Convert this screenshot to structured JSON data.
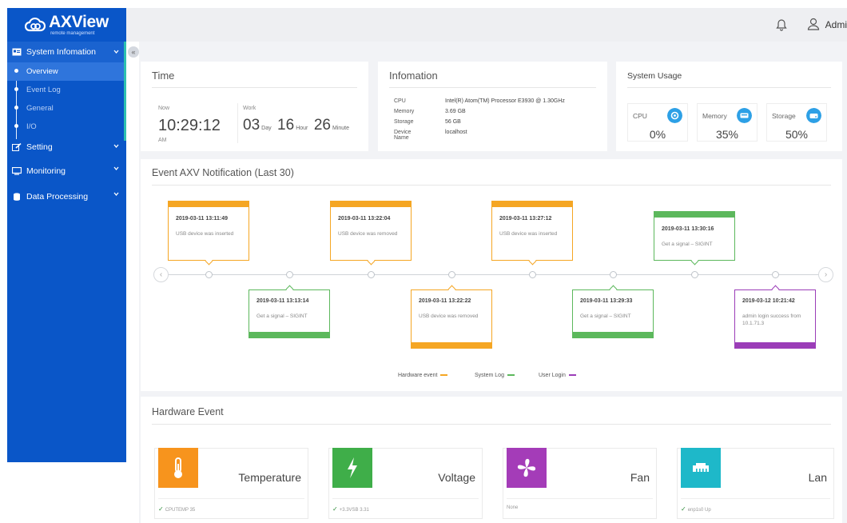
{
  "app": {
    "logo_title": "AXView",
    "logo_subtitle": "remote management",
    "user_label": "Admi"
  },
  "sidebar": {
    "groups": [
      {
        "label": "System Infomation",
        "items": [
          "Overview",
          "Event Log",
          "General",
          "I/O"
        ]
      },
      {
        "label": "Setting"
      },
      {
        "label": "Monitoring"
      },
      {
        "label": "Data Processing"
      }
    ],
    "collapse_glyph": "«"
  },
  "time_card": {
    "title": "Time",
    "now_label": "Now",
    "clock": "10:29:12",
    "ampm": "AM",
    "work_label": "Work",
    "days": "03",
    "day_unit": "Day",
    "hours": "16",
    "hour_unit": "Hour",
    "minutes": "26",
    "minute_unit": "Minute"
  },
  "info_card": {
    "title": "Infomation",
    "rows": [
      {
        "key": "CPU",
        "value": "Intel(R) Atom(TM) Processor E3930 @ 1.30GHz"
      },
      {
        "key": "Memory",
        "value": "3.69 GB"
      },
      {
        "key": "Storage",
        "value": "56 GB"
      },
      {
        "key": "Device Name",
        "value": "localhost"
      }
    ]
  },
  "usage_card": {
    "title": "System Usage",
    "cpu": {
      "label": "CPU",
      "value": "0%"
    },
    "memory": {
      "label": "Memory",
      "value": "35%"
    },
    "storage": {
      "label": "Storage",
      "value": "50%"
    }
  },
  "timeline": {
    "title": "Event AXV Notification (Last 30)",
    "prev_glyph": "‹",
    "next_glyph": "›",
    "events": [
      {
        "time": "2019-03-11 13:11:49",
        "desc": "USB device was inserted",
        "type": "hardware"
      },
      {
        "time": "2019-03-11 13:13:14",
        "desc": "Get a signal – SIGINT",
        "type": "system"
      },
      {
        "time": "2019-03-11 13:22:04",
        "desc": "USB device was removed",
        "type": "hardware"
      },
      {
        "time": "2019-03-11 13:22:22",
        "desc": "USB device was removed",
        "type": "hardware"
      },
      {
        "time": "2019-03-11 13:27:12",
        "desc": "USB device was inserted",
        "type": "hardware"
      },
      {
        "time": "2019-03-11 13:29:33",
        "desc": "Get a signal – SIGINT",
        "type": "system"
      },
      {
        "time": "2019-03-11 13:30:16",
        "desc": "Get a signal – SIGINT",
        "type": "system"
      },
      {
        "time": "2019-03-12 10:21:42",
        "desc": "admin login success from 10.1.71.3",
        "type": "login"
      }
    ],
    "legend": {
      "hardware": "Hardware event",
      "system": "System Log",
      "login": "User Login"
    },
    "colors": {
      "hardware": "#f5a623",
      "system": "#5cb85c",
      "login": "#9b3db8"
    }
  },
  "hardware_card": {
    "title": "Hardware Event",
    "items": [
      {
        "name": "Temperature",
        "status": "CPUTEMP 35",
        "ok": true,
        "color": "#f7941d",
        "icon": "thermometer-icon"
      },
      {
        "name": "Voltage",
        "status": "+3.3VSB 3.31",
        "ok": true,
        "color": "#3fae49",
        "icon": "bolt-icon"
      },
      {
        "name": "Fan",
        "status": "None",
        "ok": false,
        "color": "#a43cb8",
        "icon": "fan-icon"
      },
      {
        "name": "Lan",
        "status": "enp1s0 Up",
        "ok": true,
        "color": "#1eb8c9",
        "icon": "network-icon"
      }
    ]
  }
}
